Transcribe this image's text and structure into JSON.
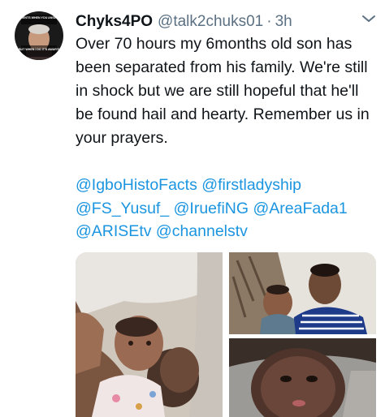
{
  "tweet": {
    "display_name": "Chyks4PO",
    "handle": "@talk2chuks01",
    "separator": "·",
    "time": "3h",
    "body": "Over 70 hours my 6months old son has been separated from his family. We're still in shock but we are still hopeful that he'll be found hail and hearty. Remember us in your prayers.",
    "mentions": [
      "@IgboHistoFacts",
      "@firstladyship",
      "@FS_Yusuf_",
      "@IruefiNG",
      "@AreaFada1",
      "@ARISEtv",
      "@channelstv"
    ]
  },
  "avatar": {
    "caption_top": "THE MOMENTS WHEN YOU ANSWER NOW",
    "caption_bottom": "BUT WHEN I DO IT'S AWAR'S"
  },
  "icons": {
    "more": "more-options-icon"
  },
  "colors": {
    "link": "#1b95e0",
    "secondary": "#5b7083",
    "text": "#0f1419"
  }
}
